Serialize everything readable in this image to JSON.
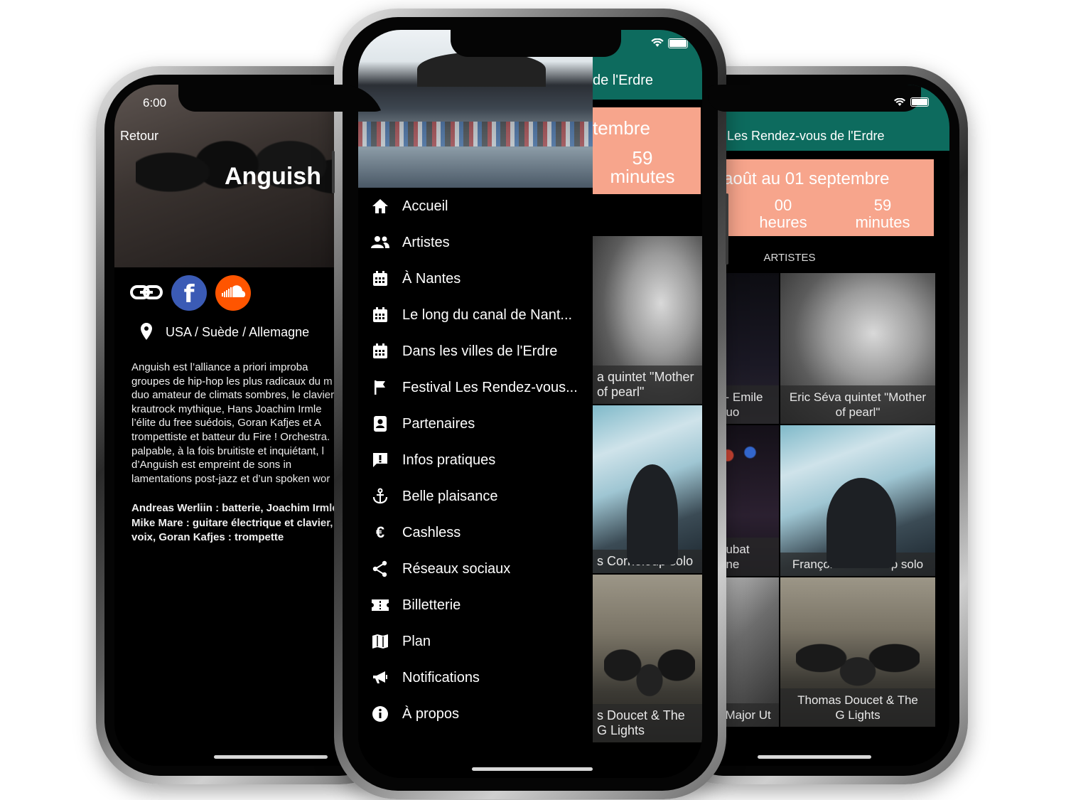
{
  "left_phone": {
    "status_time": "6:00",
    "back_label": "Retour",
    "artist_name": "Anguish",
    "location": "USA / Suède / Allemagne",
    "description_lines": [
      "Anguish  est  l’alliance  a  priori  improba",
      "groupes de hip-hop les plus radicaux du m",
      "duo amateur de climats sombres, le clavier",
      "krautrock mythique, Hans Joachim Irmle",
      "l’élite du free suédois, Goran Kafjes et A",
      "trompettiste et batteur du Fire ! Orchestra.",
      "palpable, à la fois bruitiste et inquiétant, l",
      "d’Anguish  est  empreint  de  sons  in",
      "lamentations post-jazz et d’un spoken wor"
    ],
    "credits_lines": [
      "Andreas Werliin : batterie, Joachim Irmle",
      "Mike Mare : guitare électrique et clavier,",
      "voix, Goran Kafjes : trompette"
    ]
  },
  "middle_phone": {
    "header_title_fragment": "de l'Erdre",
    "countdown_date_fragment": "tembre",
    "countdown_minutes_value": "59",
    "countdown_minutes_label": "minutes",
    "menu": [
      {
        "label": "Accueil",
        "icon": "home-icon"
      },
      {
        "label": "Artistes",
        "icon": "people-icon"
      },
      {
        "label": "À Nantes",
        "icon": "calendar-icon"
      },
      {
        "label": "Le long du canal de Nant...",
        "icon": "calendar-icon"
      },
      {
        "label": "Dans les villes de l'Erdre",
        "icon": "calendar-icon"
      },
      {
        "label": "Festival Les Rendez-vous...",
        "icon": "flag-icon"
      },
      {
        "label": "Partenaires",
        "icon": "contact-book-icon"
      },
      {
        "label": "Infos pratiques",
        "icon": "alert-message-icon"
      },
      {
        "label": "Belle plaisance",
        "icon": "anchor-icon"
      },
      {
        "label": "Cashless",
        "icon": "euro-icon"
      },
      {
        "label": "Réseaux sociaux",
        "icon": "share-icon"
      },
      {
        "label": "Billetterie",
        "icon": "ticket-icon"
      },
      {
        "label": "Plan",
        "icon": "map-icon"
      },
      {
        "label": "Notifications",
        "icon": "megaphone-icon"
      },
      {
        "label": "À propos",
        "icon": "info-icon"
      }
    ],
    "tiles": [
      {
        "caption_l1": "a quintet \"Mother",
        "caption_l2": "of pearl\""
      },
      {
        "caption_l1": "s Corneloup solo",
        "caption_l2": ""
      },
      {
        "caption_l1": "s Doucet & The",
        "caption_l2": "G Lights"
      }
    ]
  },
  "right_phone": {
    "header_title": "l Les Rendez-vous de l'Erdre",
    "countdown_date": "août au 01 septembre",
    "hours_value": "00",
    "hours_label": "heures",
    "minutes_value": "59",
    "minutes_label": "minutes",
    "section_label": "ARTISTES",
    "left_col_captions": [
      {
        "l1": "i - Emile",
        "l2": "duo"
      },
      {
        "l1": "Lubat",
        "l2": "gne"
      },
      {
        "l1": "l Major Ut",
        "l2": ""
      }
    ],
    "tiles": [
      {
        "caption_l1": "Eric Séva quintet \"Mother",
        "caption_l2": "of pearl\""
      },
      {
        "caption_l1": "François Corneloup solo",
        "caption_l2": ""
      },
      {
        "caption_l1": "Thomas Doucet & The",
        "caption_l2": "G Lights"
      }
    ]
  },
  "colors": {
    "teal_header": "#0d6b5e",
    "countdown_salmon": "#f7a58c",
    "facebook_blue": "#3b5bb5",
    "soundcloud_orange": "#ff5500"
  }
}
